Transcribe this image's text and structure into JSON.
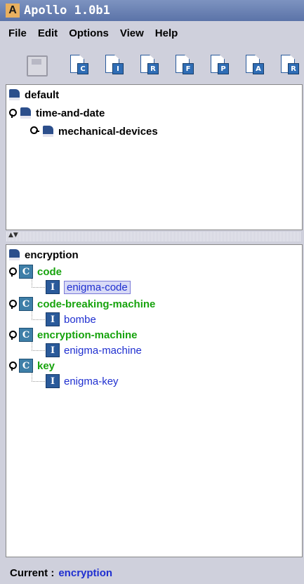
{
  "window": {
    "title": "Apollo 1.0b1",
    "app_icon_letter": "A"
  },
  "menu": [
    "File",
    "Edit",
    "Options",
    "View",
    "Help"
  ],
  "toolbar": {
    "save_icon": "save-icon",
    "buttons": [
      {
        "letter": "C",
        "icon": "new-class-icon"
      },
      {
        "letter": "I",
        "icon": "new-instance-icon"
      },
      {
        "letter": "R",
        "icon": "new-relation-icon"
      },
      {
        "letter": "F",
        "icon": "new-function-icon"
      },
      {
        "letter": "P",
        "icon": "new-property-icon"
      },
      {
        "letter": "A",
        "icon": "new-axiom-icon"
      },
      {
        "letter": "R",
        "icon": "new-rule-icon"
      }
    ]
  },
  "ontology_tree": {
    "root": "default",
    "child": "time-and-date",
    "grandchild": "mechanical-devices"
  },
  "class_tree": {
    "root": "encryption",
    "classes": [
      {
        "name": "code",
        "instance": "enigma-code",
        "selected": true
      },
      {
        "name": "code-breaking-machine",
        "instance": "bombe",
        "selected": false
      },
      {
        "name": "encryption-machine",
        "instance": "enigma-machine",
        "selected": false
      },
      {
        "name": "key",
        "instance": "enigma-key",
        "selected": false
      }
    ],
    "class_letter": "C",
    "instance_letter": "I"
  },
  "status": {
    "label": "Current :",
    "value": "encryption"
  },
  "colors": {
    "class": "#17a30d",
    "instance": "#1f2fd0",
    "status_value": "#1f2fd0"
  }
}
